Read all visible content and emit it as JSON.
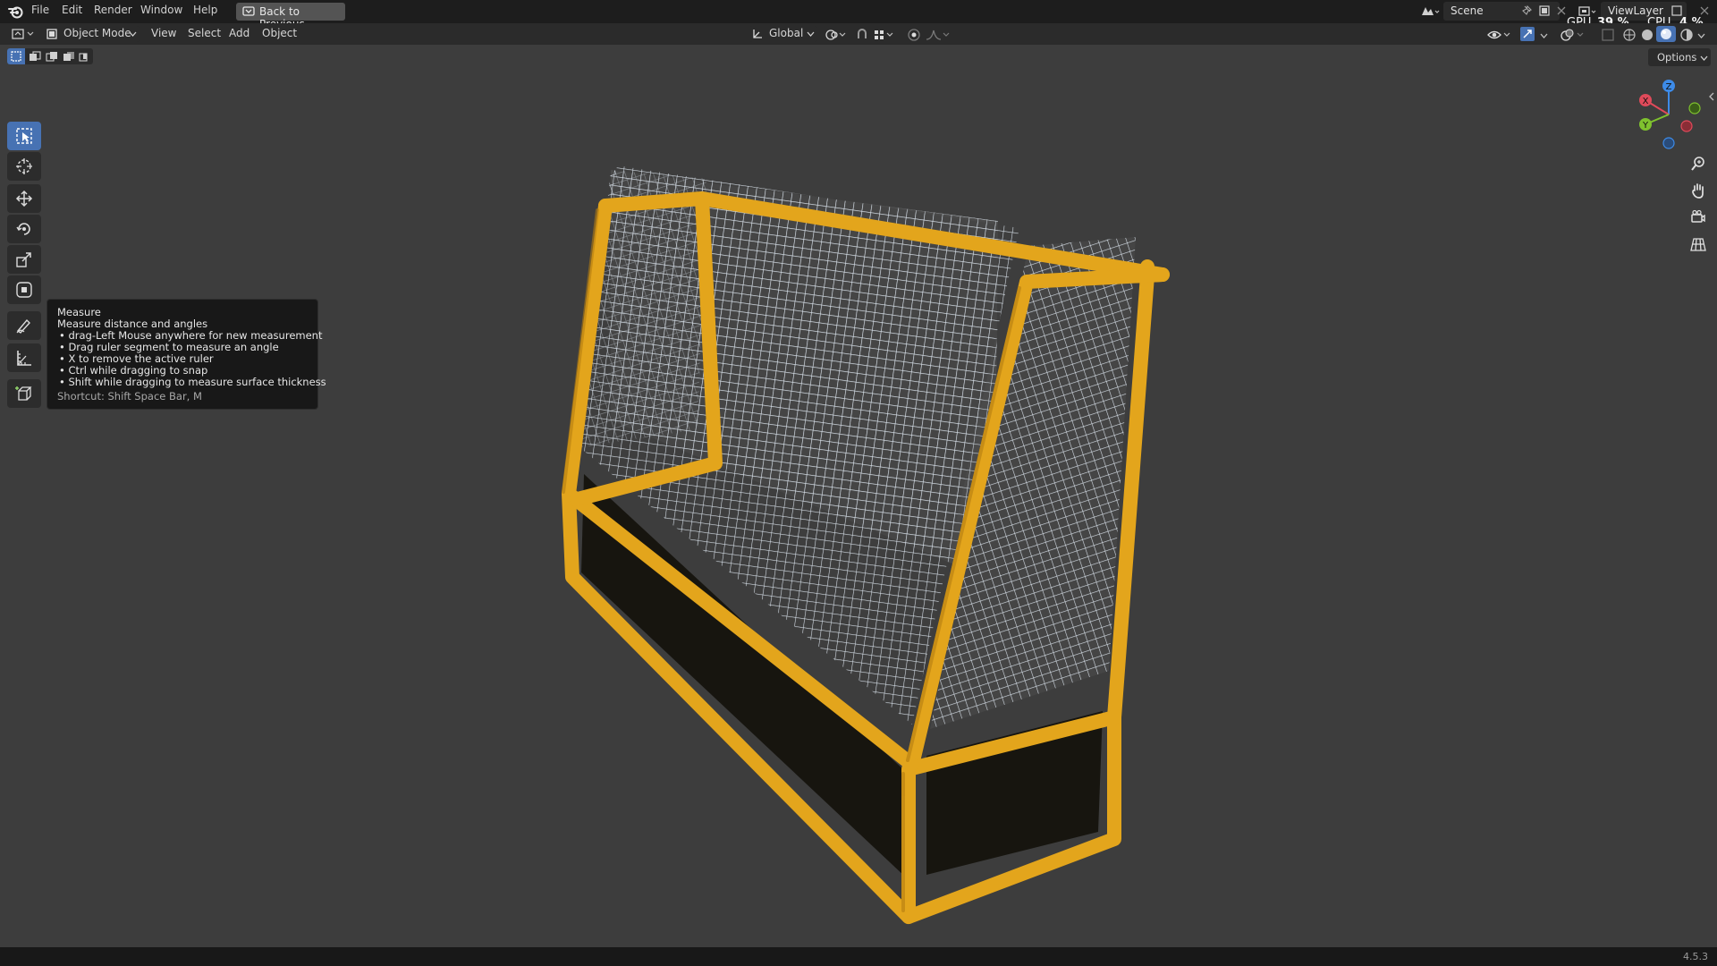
{
  "menubar": {
    "items": [
      "File",
      "Edit",
      "Render",
      "Window",
      "Help"
    ],
    "back_button": "Back to Previous",
    "scene": "Scene",
    "view_layer": "ViewLayer",
    "gpu_label": "GPU",
    "gpu_value": "39 %",
    "cpu_label": "CPU",
    "cpu_value": "4 %"
  },
  "header": {
    "mode": "Object Mode",
    "menus": [
      "View",
      "Select",
      "Add",
      "Object"
    ],
    "transform_orientation": "Global",
    "options": "Options"
  },
  "toolbar": {
    "tools": [
      "select-box",
      "cursor",
      "move",
      "rotate",
      "scale",
      "transform",
      "annotate",
      "measure",
      "add-cube"
    ],
    "active_tool": "select-box"
  },
  "tooltip": {
    "title": "Measure",
    "description": "Measure distance and angles",
    "bullets": [
      "• drag-Left Mouse anywhere for new measurement",
      "• Drag ruler segment to measure an angle",
      "• X to remove the active ruler",
      "• Ctrl while dragging to snap",
      "• Shift while dragging to measure surface thickness"
    ],
    "shortcut": "Shortcut: Shift Space Bar, M"
  },
  "gizmo": {
    "x": "X",
    "y": "Y",
    "z": "Z"
  },
  "status": {
    "version": "4.5.3"
  },
  "colors": {
    "frame": "#e3a51c",
    "accent": "#4772b3",
    "viewport_bg": "#3d3d3d",
    "axis_x": "#e04a5a",
    "axis_y": "#7fc22e",
    "axis_z": "#3d8be8"
  }
}
